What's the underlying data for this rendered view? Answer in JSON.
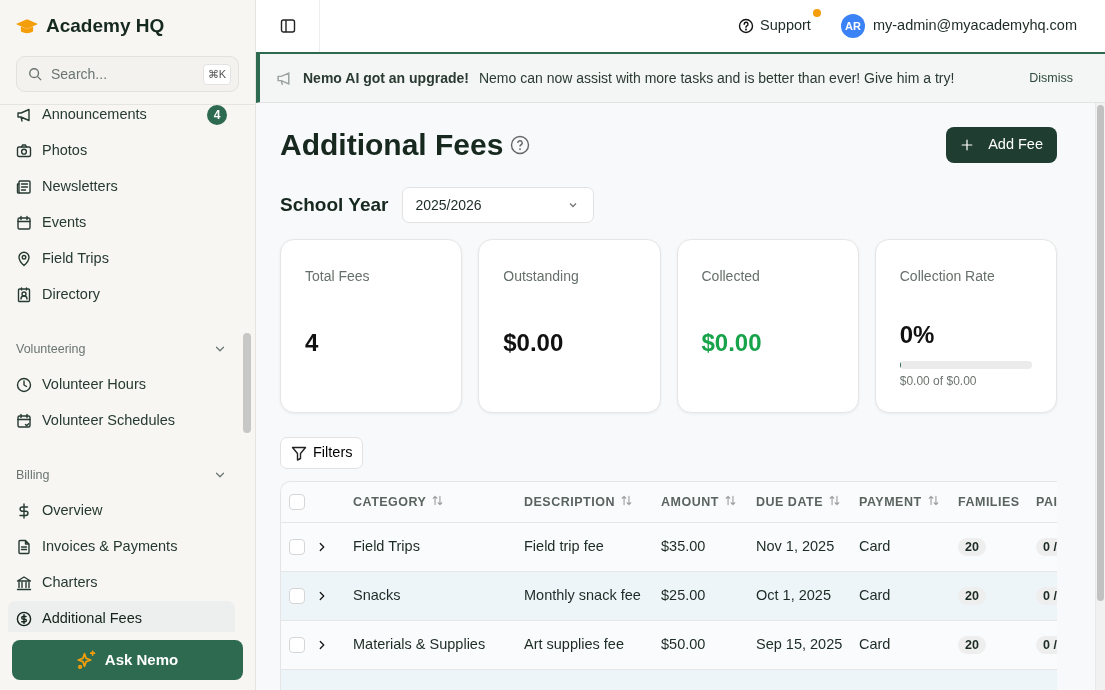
{
  "app": {
    "name": "Academy HQ"
  },
  "search": {
    "placeholder": "Search...",
    "shortcut": "⌘K"
  },
  "sidebar": {
    "groups": [
      {
        "items": [
          {
            "label": "Announcements",
            "selected": false,
            "badge": "4"
          },
          {
            "label": "Photos",
            "selected": false
          },
          {
            "label": "Newsletters",
            "selected": false
          },
          {
            "label": "Events",
            "selected": false
          },
          {
            "label": "Field Trips",
            "selected": false
          },
          {
            "label": "Directory",
            "selected": false
          }
        ]
      },
      {
        "title": "Volunteering",
        "expanded": true,
        "items": [
          {
            "label": "Volunteer Hours",
            "selected": false
          },
          {
            "label": "Volunteer Schedules",
            "selected": false
          }
        ]
      },
      {
        "title": "Billing",
        "expanded": true,
        "items": [
          {
            "label": "Overview",
            "selected": false
          },
          {
            "label": "Invoices & Payments",
            "selected": false
          },
          {
            "label": "Charters",
            "selected": false
          },
          {
            "label": "Additional Fees",
            "selected": true
          }
        ]
      }
    ],
    "ask_button": "Ask Nemo"
  },
  "header": {
    "support": "Support",
    "support_notification": true,
    "avatar": "AR",
    "user": "my-admin@myacademyhq.com"
  },
  "banner": {
    "title": "Nemo AI got an upgrade!",
    "message": "Nemo can now assist with more tasks and is better than ever! Give him a try!",
    "dismiss": "Dismiss"
  },
  "page": {
    "title": "Additional Fees",
    "add_button": "Add Fee",
    "school_year_label": "School Year",
    "school_year": "2025/2026"
  },
  "stats": [
    {
      "label": "Total Fees",
      "value": "4",
      "kind": "plain"
    },
    {
      "label": "Outstanding",
      "value": "$0.00",
      "kind": "plain"
    },
    {
      "label": "Collected",
      "value": "$0.00",
      "kind": "positive"
    },
    {
      "label": "Collection Rate",
      "value": "0%",
      "kind": "rate",
      "level": 0,
      "caption": "$0.00 of $0.00"
    }
  ],
  "filters_button": "Filters",
  "table": {
    "all_selected": false,
    "columns": [
      {
        "label": "CATEGORY",
        "sortable": true
      },
      {
        "label": "DESCRIPTION",
        "sortable": true
      },
      {
        "label": "AMOUNT",
        "sortable": true
      },
      {
        "label": "DUE DATE",
        "sortable": true
      },
      {
        "label": "PAYMENT",
        "sortable": true
      },
      {
        "label": "FAMILIES",
        "sortable": false
      },
      {
        "label": "PAI",
        "sortable": false
      }
    ],
    "rows": [
      {
        "selected": false,
        "expanded": false,
        "category": "Field Trips",
        "description": "Field trip fee",
        "amount": "$35.00",
        "due_date": "Nov 1, 2025",
        "payment": "Card",
        "families": "20",
        "paid": "0 /"
      },
      {
        "selected": false,
        "expanded": false,
        "category": "Snacks",
        "description": "Monthly snack fee",
        "amount": "$25.00",
        "due_date": "Oct 1, 2025",
        "payment": "Card",
        "families": "20",
        "paid": "0 /"
      },
      {
        "selected": false,
        "expanded": false,
        "category": "Materials & Supplies",
        "description": "Art supplies fee",
        "amount": "$50.00",
        "due_date": "Sep 15, 2025",
        "payment": "Card",
        "families": "20",
        "paid": "0 /"
      }
    ]
  }
}
